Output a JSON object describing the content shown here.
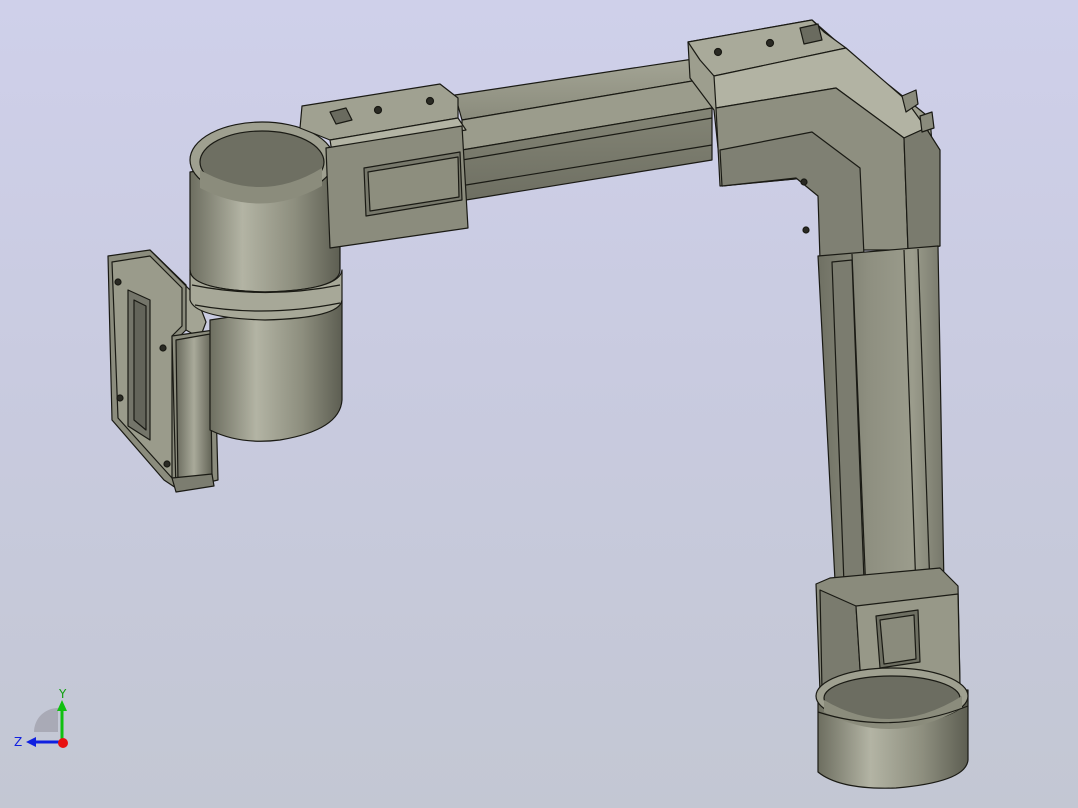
{
  "viewport": {
    "background_top": "#cfd0ea",
    "background_bottom": "#c3c7d3"
  },
  "model": {
    "part": "duct-elbow-assembly",
    "material_color": "#8e8f7f",
    "edge_color": "#1a1a14"
  },
  "triad": {
    "x_color": "#e81010",
    "y_color": "#10c010",
    "z_color": "#1020e0",
    "y_label": "Y",
    "z_label": "Z"
  }
}
